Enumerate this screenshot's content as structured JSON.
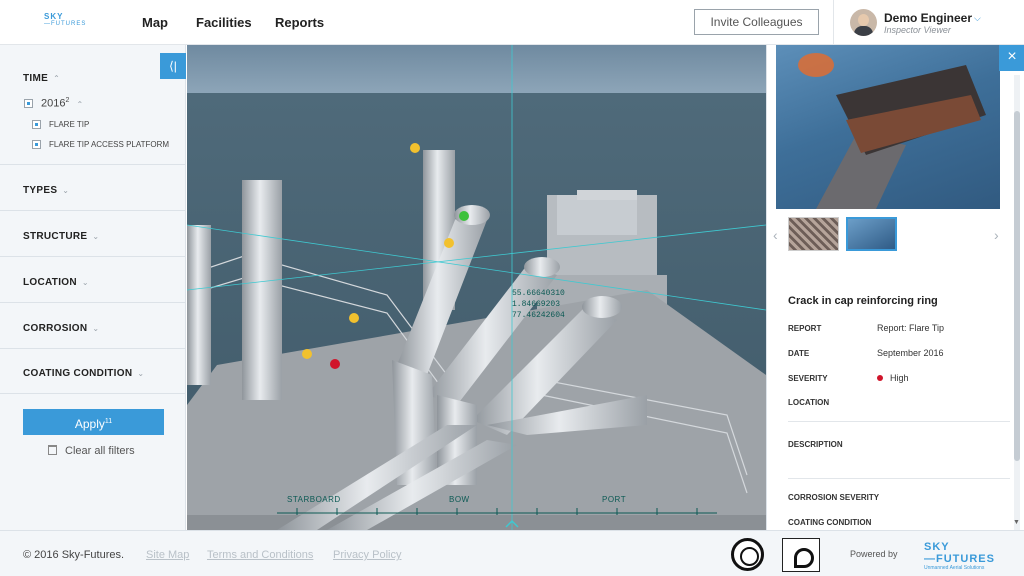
{
  "header": {
    "logo_top": "SKY",
    "logo_bottom": "FUTURES",
    "nav": [
      "Map",
      "Facilities",
      "Reports"
    ],
    "invite_label": "Invite Colleagues",
    "user_name": "Demo Engineer",
    "user_role": "Inspector Viewer"
  },
  "sidebar": {
    "time_label": "TIME",
    "year": "2016",
    "year_count": "2",
    "sub_items": [
      "FLARE TIP",
      "FLARE TIP ACCESS PLATFORM"
    ],
    "filters": [
      "TYPES",
      "STRUCTURE",
      "LOCATION",
      "CORROSION",
      "COATING CONDITION"
    ],
    "apply_label": "Apply",
    "apply_count": "11",
    "clear_label": "Clear all filters"
  },
  "viewer": {
    "coords": [
      "55.66640310",
      "1.84669203",
      "77.46242604"
    ],
    "compass": [
      "STARBOARD",
      "BOW",
      "PORT"
    ]
  },
  "finding": {
    "title": "Crack in cap reinforcing ring",
    "report_label": "REPORT",
    "report_value": "Report: Flare Tip",
    "date_label": "DATE",
    "date_value": "September 2016",
    "severity_label": "SEVERITY",
    "severity_value": "High",
    "severity_color": "#d0142a",
    "location_label": "LOCATION",
    "description_label": "DESCRIPTION",
    "corrosion_label": "CORROSION SEVERITY",
    "coating_label": "COATING CONDITION"
  },
  "footer": {
    "copyright": "© 2016 Sky-Futures.",
    "links": [
      "Site Map",
      "Terms and Conditions",
      "Privacy Policy"
    ],
    "powered_by": "Powered by",
    "logo_top": "SKY",
    "logo_bottom": "FUTURES",
    "logo_tagline": "Unmanned Aerial Solutions"
  },
  "colors": {
    "accent": "#3a9ad9",
    "severity_high": "#d0142a",
    "marker_yellow": "#f2c12e",
    "marker_green": "#3cc13b",
    "marker_red": "#d0142a"
  }
}
